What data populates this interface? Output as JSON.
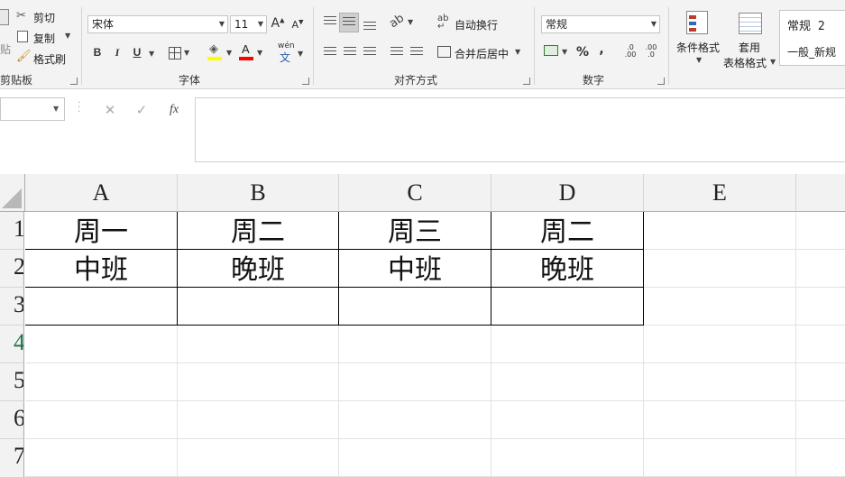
{
  "ribbon": {
    "clipboard": {
      "paste_label": "粘贴",
      "cut_label": "剪切",
      "copy_label": "复制",
      "format_painter_label": "格式刷",
      "group_label": "剪贴板"
    },
    "font": {
      "font_name": "宋体",
      "font_size": "11",
      "bold": "B",
      "italic": "I",
      "underline": "U",
      "phonetic": "wén",
      "phonetic_char": "文",
      "group_label": "字体"
    },
    "alignment": {
      "wrap_text_label": "自动换行",
      "merge_center_label": "合并后居中",
      "group_label": "对齐方式"
    },
    "number": {
      "format": "常规",
      "percent": "%",
      "comma": ",",
      "group_label": "数字"
    },
    "styles": {
      "conditional_format_label": "条件格式",
      "table_format_label_1": "套用",
      "table_format_label_2": "表格格式",
      "style_1": "常规 2",
      "style_2": "一般_新规"
    }
  },
  "formula_bar": {
    "name_box": "",
    "cancel": "✕",
    "enter": "✓",
    "fx": "fx",
    "content": ""
  },
  "sheet": {
    "columns": [
      "A",
      "B",
      "C",
      "D",
      "E"
    ],
    "rows": [
      "1",
      "2",
      "3",
      "4",
      "5",
      "6",
      "7"
    ],
    "cells": [
      [
        "周一",
        "周二",
        "周三",
        "周二"
      ],
      [
        "中班",
        "晚班",
        "中班",
        "晚班"
      ],
      [
        "",
        "",
        "",
        ""
      ]
    ]
  },
  "colors": {
    "highlight": "#ffff00",
    "font_color": "#ff0000",
    "selected_row": "#1e7145"
  }
}
